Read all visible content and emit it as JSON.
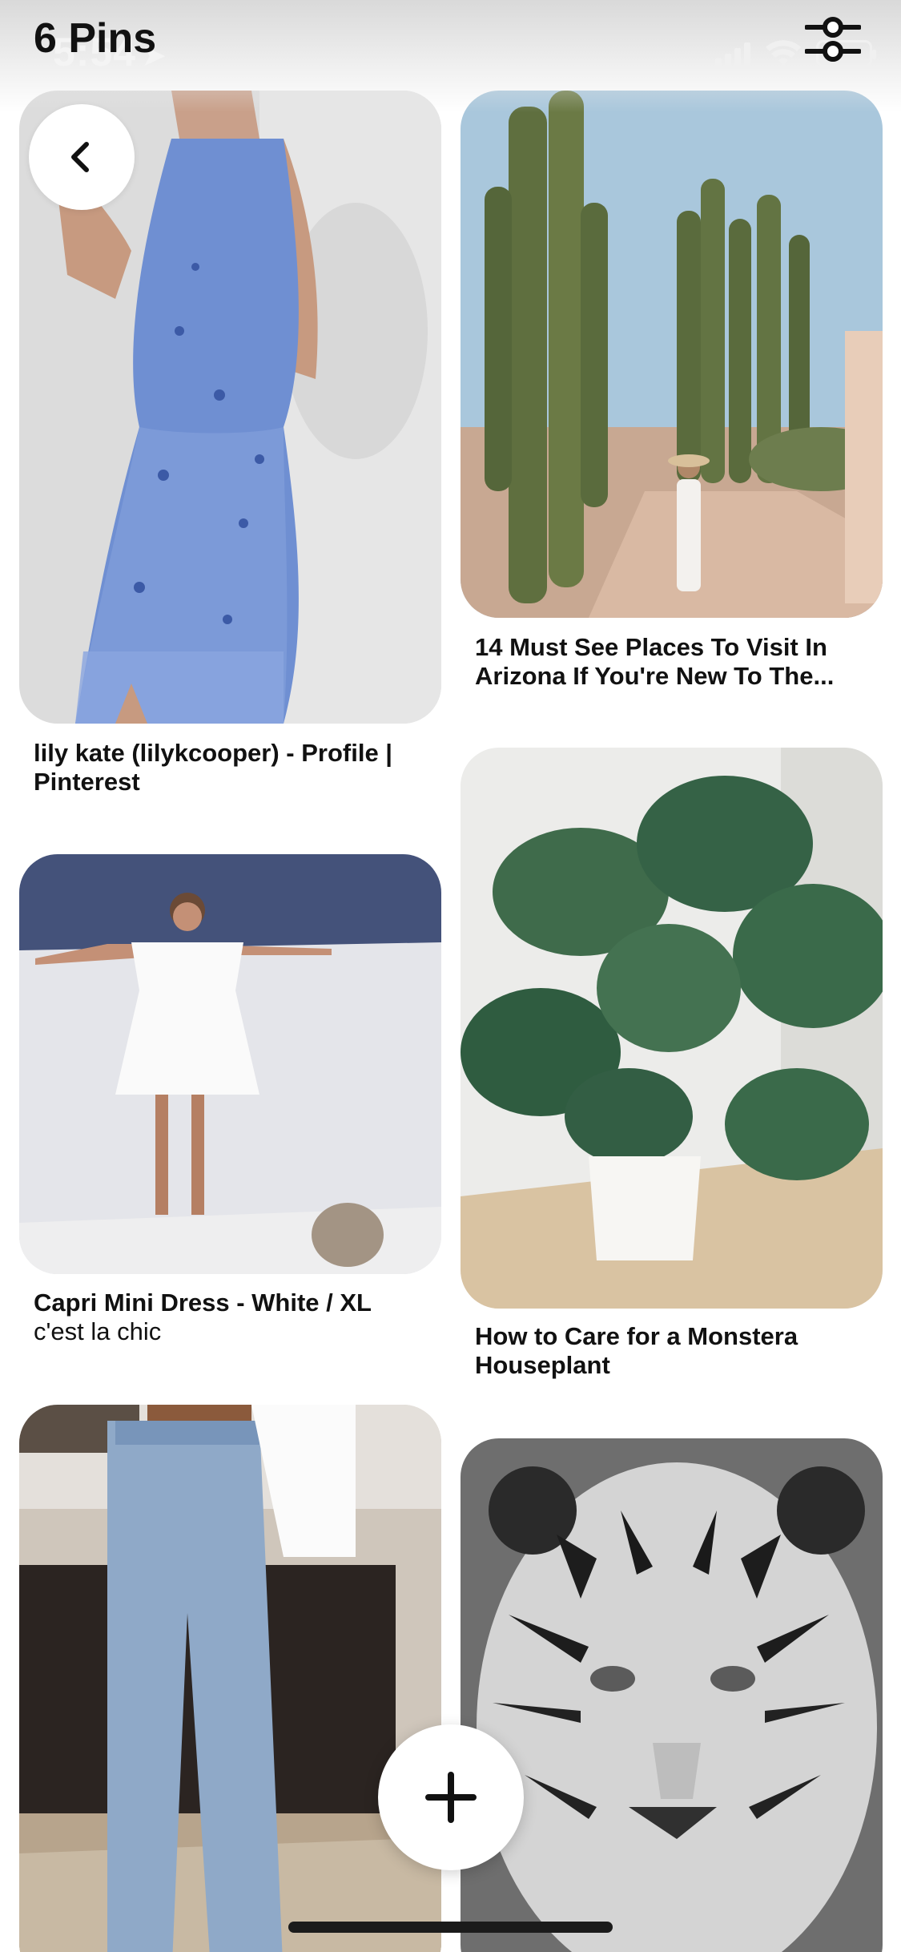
{
  "status_bar": {
    "time": "5:54",
    "location_arrow": "location-arrow-icon"
  },
  "header": {
    "title": "6 Pins"
  },
  "icons": {
    "back": "chevron-left-icon",
    "filter": "filter-sliders-icon",
    "add": "plus-icon"
  },
  "pins": [
    {
      "title": "lily kate (lilykcooper) - Profile | Pinterest",
      "subtitle": ""
    },
    {
      "title": "14 Must See Places To Visit In Arizona If You're New To The...",
      "subtitle": ""
    },
    {
      "title": "Capri Mini Dress - White / XL",
      "subtitle": "c'est la chic"
    },
    {
      "title": "How to Care for a Monstera Houseplant",
      "subtitle": ""
    },
    {
      "title": "",
      "subtitle": ""
    },
    {
      "title": "",
      "subtitle": ""
    }
  ],
  "colors": {
    "background": "#ffffff",
    "text": "#111111"
  }
}
